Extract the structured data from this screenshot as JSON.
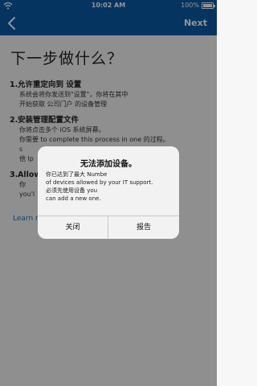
{
  "status_bar": {
    "time": "10:02 AM",
    "battery": "100%"
  },
  "nav": {
    "next_label": "Next"
  },
  "page": {
    "title": "下一步做什么？",
    "steps": [
      {
        "num": "1.",
        "head": "允许重定向到 设置",
        "lines": [
          "系统会将你发送到\"设置\"，你将在其中",
          "开始获取 公司门户 的设备管理"
        ]
      },
      {
        "num": "2.",
        "head": "安装管理配置文件",
        "lines": [
          "你将点击多个 iOS 系统屏幕。",
          "你需要 to complete this process in one 的过程。",
          "s",
          "他 lp"
        ]
      },
      {
        "num": "3.",
        "head": "Allow",
        "lines": [
          "你",
          "you'l"
        ]
      }
    ],
    "learn_more": "Learn m"
  },
  "dialog": {
    "title": "无法添加设备。",
    "message_lines": [
      "你已达到了最大 Numbe",
      "of devices allowed by your IT support.",
      "必须先使用设备 you",
      "can add a new one."
    ],
    "buttons": {
      "close": "关闭",
      "report": "报告"
    }
  }
}
